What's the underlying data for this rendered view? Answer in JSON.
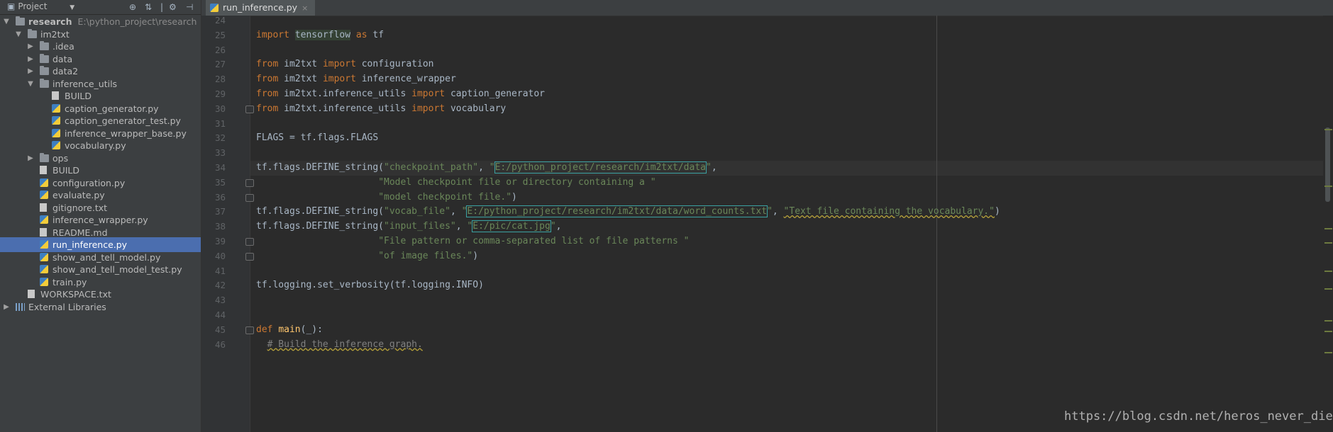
{
  "project_panel": {
    "title": "Project",
    "tree": [
      {
        "label": "research",
        "path": "E:\\python_project\\research",
        "type": "folder",
        "bold": true,
        "depth": 0,
        "arrow": "▼"
      },
      {
        "label": "im2txt",
        "type": "folder",
        "depth": 1,
        "arrow": "▼"
      },
      {
        "label": ".idea",
        "type": "folder",
        "depth": 2,
        "arrow": "▶"
      },
      {
        "label": "data",
        "type": "folder",
        "depth": 2,
        "arrow": "▶"
      },
      {
        "label": "data2",
        "type": "folder",
        "depth": 2,
        "arrow": "▶"
      },
      {
        "label": "inference_utils",
        "type": "folder",
        "depth": 2,
        "arrow": "▼"
      },
      {
        "label": "BUILD",
        "type": "file",
        "depth": 3
      },
      {
        "label": "caption_generator.py",
        "type": "py",
        "depth": 3
      },
      {
        "label": "caption_generator_test.py",
        "type": "py",
        "depth": 3
      },
      {
        "label": "inference_wrapper_base.py",
        "type": "py",
        "depth": 3
      },
      {
        "label": "vocabulary.py",
        "type": "py",
        "depth": 3
      },
      {
        "label": "ops",
        "type": "folder",
        "depth": 2,
        "arrow": "▶"
      },
      {
        "label": "BUILD",
        "type": "file",
        "depth": 2
      },
      {
        "label": "configuration.py",
        "type": "py",
        "depth": 2
      },
      {
        "label": "evaluate.py",
        "type": "py",
        "depth": 2
      },
      {
        "label": "gitignore.txt",
        "type": "file",
        "depth": 2
      },
      {
        "label": "inference_wrapper.py",
        "type": "py",
        "depth": 2
      },
      {
        "label": "README.md",
        "type": "file",
        "depth": 2
      },
      {
        "label": "run_inference.py",
        "type": "py",
        "depth": 2,
        "selected": true
      },
      {
        "label": "show_and_tell_model.py",
        "type": "py",
        "depth": 2
      },
      {
        "label": "show_and_tell_model_test.py",
        "type": "py",
        "depth": 2
      },
      {
        "label": "train.py",
        "type": "py",
        "depth": 2
      },
      {
        "label": "WORKSPACE.txt",
        "type": "file",
        "depth": 1
      },
      {
        "label": "External Libraries",
        "type": "lib",
        "depth": 0,
        "arrow": "▶"
      }
    ]
  },
  "editor": {
    "tab_label": "run_inference.py",
    "tab_close": "×",
    "lines": [
      {
        "n": "24",
        "html": ""
      },
      {
        "n": "25",
        "html": "<span class=\"kw\">import</span> <span class=\"hlw\">tensorflow</span> <span class=\"kw\">as</span> tf"
      },
      {
        "n": "26",
        "html": ""
      },
      {
        "n": "27",
        "html": "<span class=\"kw\">from</span> im2txt <span class=\"kw\">import</span> configuration"
      },
      {
        "n": "28",
        "html": "<span class=\"kw\">from</span> im2txt <span class=\"kw\">import</span> inference_wrapper"
      },
      {
        "n": "29",
        "html": "<span class=\"kw\">from</span> im2txt.inference_utils <span class=\"kw\">import</span> caption_generator"
      },
      {
        "n": "30",
        "html": "<span class=\"kw\">from</span> im2txt.inference_utils <span class=\"kw\">import</span> vocabulary",
        "fold": true
      },
      {
        "n": "31",
        "html": ""
      },
      {
        "n": "32",
        "html": "FLAGS = tf.flags.FLAGS"
      },
      {
        "n": "33",
        "html": ""
      },
      {
        "n": "34",
        "html": "tf.flags.DEFINE_string(<span class=\"str\">\"checkpoint_path\"</span>, <span class=\"str\">\"<span class=\"box\">E:/python_project/research/im2txt/data</span>\"</span>,",
        "current": true
      },
      {
        "n": "35",
        "html": "                      <span class=\"str\">\"Model checkpoint file or directory containing a \"</span>",
        "fold": true
      },
      {
        "n": "36",
        "html": "                      <span class=\"str\">\"model checkpoint file.\"</span>)",
        "fold": true
      },
      {
        "n": "37",
        "html": "tf.flags.DEFINE_string(<span class=\"str\">\"vocab_file\"</span>, <span class=\"str\">\"<span class=\"box\">E:/python_project/research/im2txt/data/word_counts.txt</span>\"</span>, <span class=\"str squig\">\"Text file containing the vocabulary.\"</span>)"
      },
      {
        "n": "38",
        "html": "tf.flags.DEFINE_string(<span class=\"str\">\"input_files\"</span>, <span class=\"str\">\"<span class=\"box\">E:/pic/cat.jpg</span>\"</span>,"
      },
      {
        "n": "39",
        "html": "                      <span class=\"str\">\"File pattern or comma-separated list of file patterns \"</span>",
        "fold": true
      },
      {
        "n": "40",
        "html": "                      <span class=\"str\">\"of image files.\"</span>)",
        "fold": true
      },
      {
        "n": "41",
        "html": ""
      },
      {
        "n": "42",
        "html": "tf.logging.set_verbosity(tf.logging.INFO)"
      },
      {
        "n": "43",
        "html": ""
      },
      {
        "n": "44",
        "html": ""
      },
      {
        "n": "45",
        "html": "<span class=\"kw\">def</span> <span class=\"fn\">main</span>(_):",
        "fold": true
      },
      {
        "n": "46",
        "html": "  <span class=\"cm squig\"># Build the inference graph.</span>"
      }
    ]
  },
  "watermark": "https://blog.csdn.net/heros_never_die",
  "colors": {
    "accent": "#4b6eaf",
    "keyword": "#cc7832",
    "string": "#6a8759",
    "function": "#ffc66d"
  }
}
